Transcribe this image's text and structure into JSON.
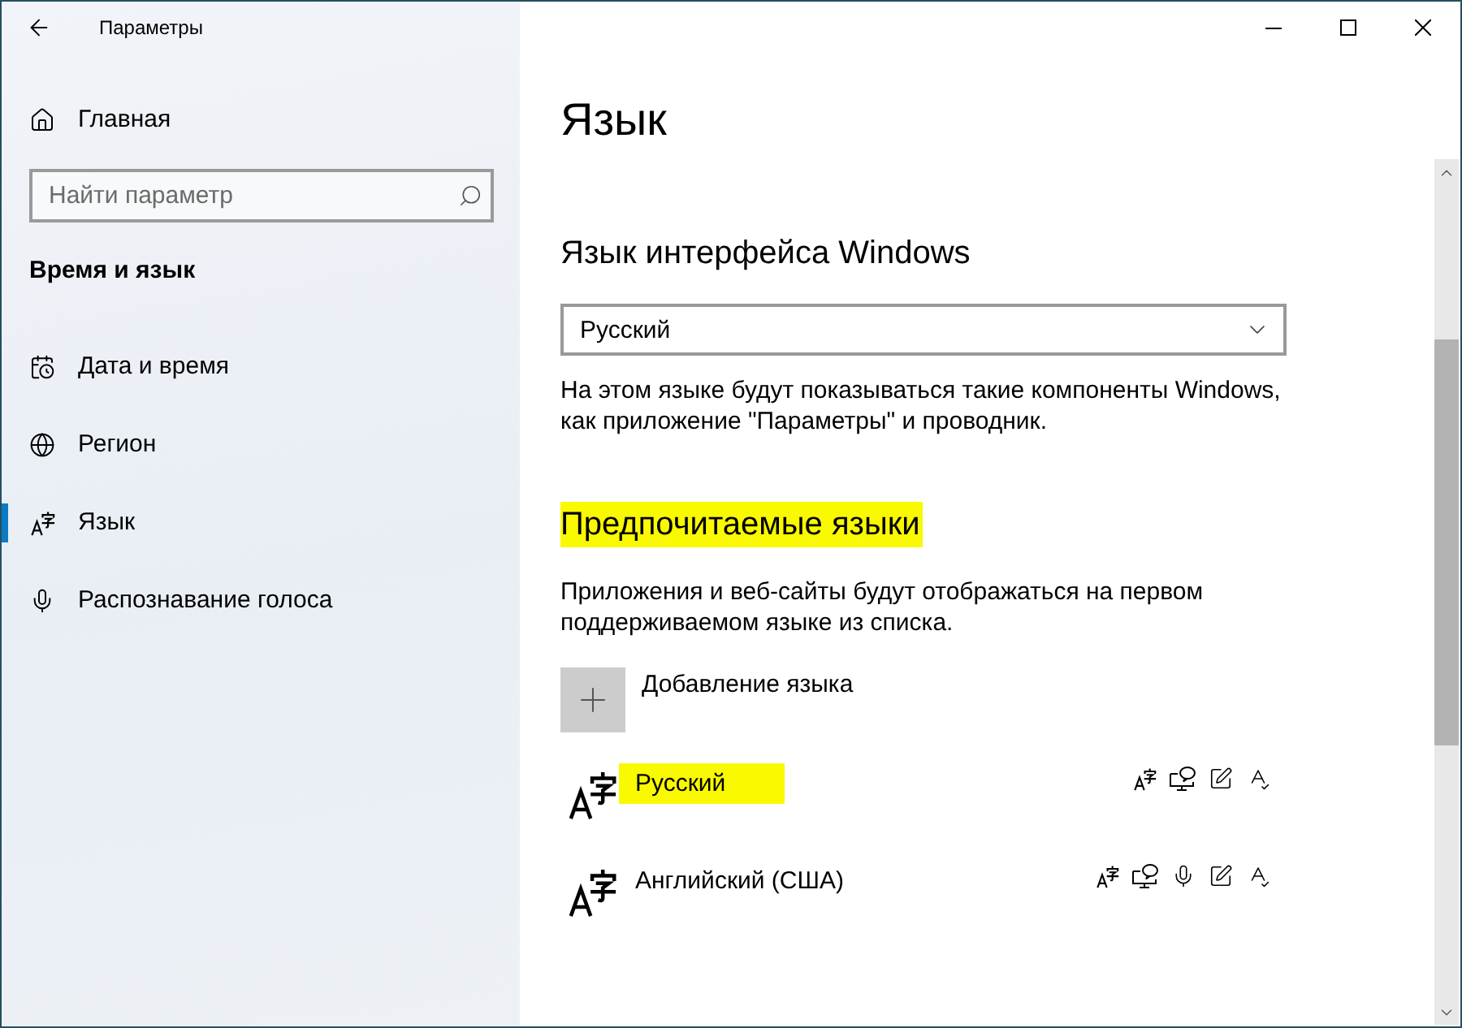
{
  "window": {
    "title": "Параметры"
  },
  "sidebar": {
    "home": "Главная",
    "search": {
      "placeholder": "Найти параметр"
    },
    "section": "Время и язык",
    "items": [
      {
        "label": "Дата и время",
        "kind": "date-time",
        "selected": false
      },
      {
        "label": "Регион",
        "kind": "region",
        "selected": false
      },
      {
        "label": "Язык",
        "kind": "language",
        "selected": true
      },
      {
        "label": "Распознавание голоса",
        "kind": "speech",
        "selected": false
      }
    ]
  },
  "page": {
    "title": "Язык",
    "display_language": {
      "heading": "Язык интерфейса Windows",
      "dropdown": {
        "value": "Русский"
      },
      "description": "На этом языке будут показываться такие компоненты Windows, как приложение \"Параметры\" и проводник."
    },
    "preferred_languages": {
      "heading": "Предпочитаемые языки",
      "highlighted": true,
      "description": "Приложения и веб-сайты будут отображаться на первом поддерживаемом языке из списка.",
      "add_button": "Добавление языка",
      "languages": [
        {
          "name": "Русский",
          "highlighted": true,
          "features": [
            {
              "kind": "language-pack"
            },
            {
              "kind": "display"
            },
            {
              "kind": "handwriting"
            },
            {
              "kind": "spelling"
            }
          ]
        },
        {
          "name": "Английский (США)",
          "highlighted": false,
          "features": [
            {
              "kind": "language-pack"
            },
            {
              "kind": "display"
            },
            {
              "kind": "speech"
            },
            {
              "kind": "handwriting"
            },
            {
              "kind": "spelling"
            }
          ]
        }
      ]
    }
  }
}
